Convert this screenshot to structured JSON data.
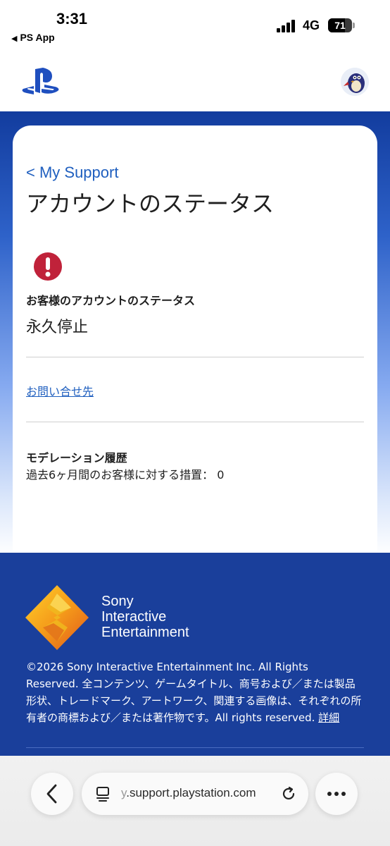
{
  "status_bar": {
    "time": "3:31",
    "back_app": "PS App",
    "network": "4G",
    "battery": "71",
    "battery_level_percent": 71
  },
  "header": {
    "logo_icon": "playstation-logo-icon",
    "avatar_icon": "user-avatar-icon"
  },
  "page": {
    "breadcrumb": "< My Support",
    "title": "アカウントのステータス",
    "status_label": "お客様のアカウントのステータス",
    "status_value": "永久停止",
    "contact_link": "お問い合せ先",
    "moderation_title": "モデレーション履歴",
    "moderation_text": "過去6ヶ月間のお客様に対する措置： 0"
  },
  "footer": {
    "company_line1": "Sony",
    "company_line2": "Interactive",
    "company_line3": "Entertainment",
    "copyright": "©2026 Sony Interactive Entertainment Inc. All Rights Reserved. 全コンテンツ、ゲームタイトル、商号および／または製品形状、トレードマーク、アートワーク、関連する画像は、それぞれの所有者の商標および／または著作物です。All rights reserved.",
    "details_link": "詳細"
  },
  "browser": {
    "url_prefix": "y",
    "url": ".support.playstation.com"
  },
  "colors": {
    "accent_link": "#1f5fbf",
    "footer_bg": "#1a3f9b",
    "alert_red": "#c0223a"
  }
}
